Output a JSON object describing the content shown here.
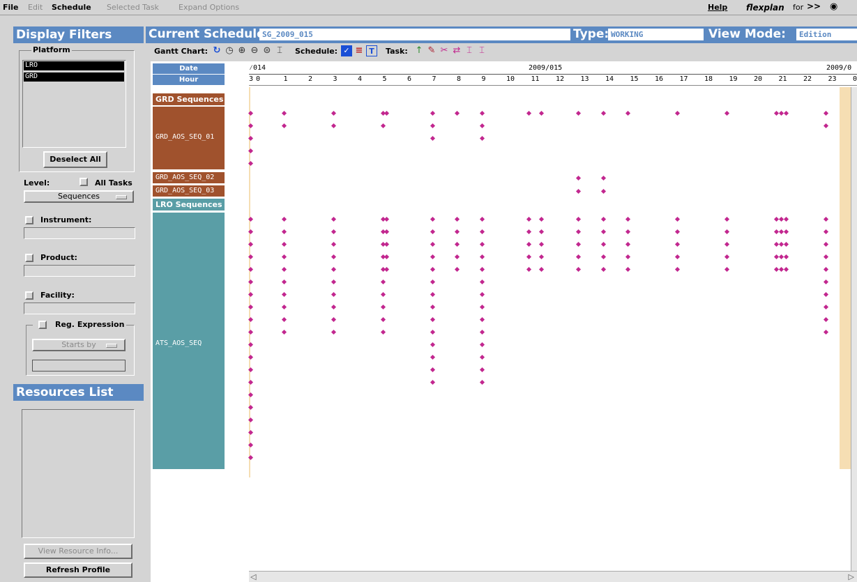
{
  "menu": {
    "file": "File",
    "edit": "Edit",
    "schedule": "Schedule",
    "selected_task": "Selected Task",
    "expand_options": "Expand Options",
    "help": "Help",
    "brand": "flexplan",
    "brand_suffix": "for"
  },
  "filters": {
    "title": "Display Filters",
    "platform_label": "Platform",
    "platforms": [
      "LRO",
      "GRD"
    ],
    "deselect_all": "Deselect All",
    "level_label": "Level:",
    "all_tasks": "All Tasks",
    "level_value": "Sequences",
    "instrument": "Instrument:",
    "product": "Product:",
    "facility": "Facility:",
    "reg_expression": "Reg. Expression",
    "starts_by": "Starts by"
  },
  "resources": {
    "title": "Resources List",
    "view_info": "View Resource Info...",
    "refresh": "Refresh Profile"
  },
  "header": {
    "current_schedule_label": "Current Schedule:",
    "current_schedule": "SG_2009_015",
    "type_label": "Type:",
    "type": "WORKING",
    "view_mode_label": "View Mode:",
    "view_mode": "Edition"
  },
  "toolbar": {
    "gantt_chart": "Gantt Chart:",
    "schedule": "Schedule:",
    "task": "Task:"
  },
  "gantt": {
    "date_label": "Date",
    "hour_label": "Hour",
    "date_left": "⁄014",
    "date_mid": "2009/015",
    "date_right": "2009/0",
    "hours": [
      "3",
      "0",
      "1",
      "2",
      "3",
      "4",
      "5",
      "6",
      "7",
      "8",
      "9",
      "10",
      "11",
      "12",
      "13",
      "14",
      "15",
      "16",
      "17",
      "18",
      "19",
      "20",
      "21",
      "22",
      "23",
      "0"
    ],
    "groups": {
      "grd": "GRD Sequences",
      "lro": "LRO Sequences"
    },
    "rows": {
      "grd1": "GRD_AOS_SEQ_01",
      "grd2": "GRD_AOS_SEQ_02",
      "grd3": "GRD_AOS_SEQ_03",
      "ats": "ATS_AOS_SEQ"
    },
    "colors": {
      "grd": "#a0522d",
      "lro": "#5a9ea6",
      "header": "#5b89c2",
      "marker": "#c2278f"
    }
  }
}
